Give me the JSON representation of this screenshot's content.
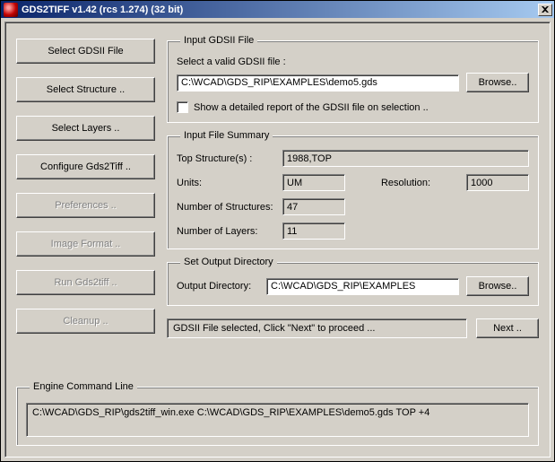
{
  "title": "GDS2TIFF v1.42 (rcs 1.274) (32 bit)",
  "sidebar": {
    "items": [
      {
        "label": "Select GDSII File",
        "enabled": true
      },
      {
        "label": "Select Structure ..",
        "enabled": true
      },
      {
        "label": "Select Layers ..",
        "enabled": true
      },
      {
        "label": "Configure Gds2Tiff ..",
        "enabled": true
      },
      {
        "label": "Preferences ..",
        "enabled": false
      },
      {
        "label": "Image Format ..",
        "enabled": false
      },
      {
        "label": "Run Gds2tiff ..",
        "enabled": false
      },
      {
        "label": "Cleanup ..",
        "enabled": false
      }
    ]
  },
  "input_group": {
    "legend": "Input GDSII File",
    "select_label": "Select a valid GDSII file :",
    "path": "C:\\WCAD\\GDS_RIP\\EXAMPLES\\demo5.gds",
    "browse": "Browse..",
    "report_label": "Show a detailed report of the GDSII file on selection .."
  },
  "summary_group": {
    "legend": "Input File Summary",
    "top_label": "Top Structure(s) :",
    "top_value": "1988,TOP",
    "units_label": "Units:",
    "units_value": "UM",
    "res_label": "Resolution:",
    "res_value": "1000",
    "nstruct_label": "Number of Structures:",
    "nstruct_value": "47",
    "nlayers_label": "Number of Layers:",
    "nlayers_value": "11"
  },
  "output_group": {
    "legend": "Set Output Directory",
    "label": "Output Directory:",
    "path": "C:\\WCAD\\GDS_RIP\\EXAMPLES",
    "browse": "Browse.."
  },
  "status": {
    "text": "GDSII File selected, Click \"Next\" to proceed ...",
    "next": "Next .."
  },
  "cmd_group": {
    "legend": "Engine Command Line",
    "text": "C:\\WCAD\\GDS_RIP\\gds2tiff_win.exe C:\\WCAD\\GDS_RIP\\EXAMPLES\\demo5.gds TOP +4"
  }
}
